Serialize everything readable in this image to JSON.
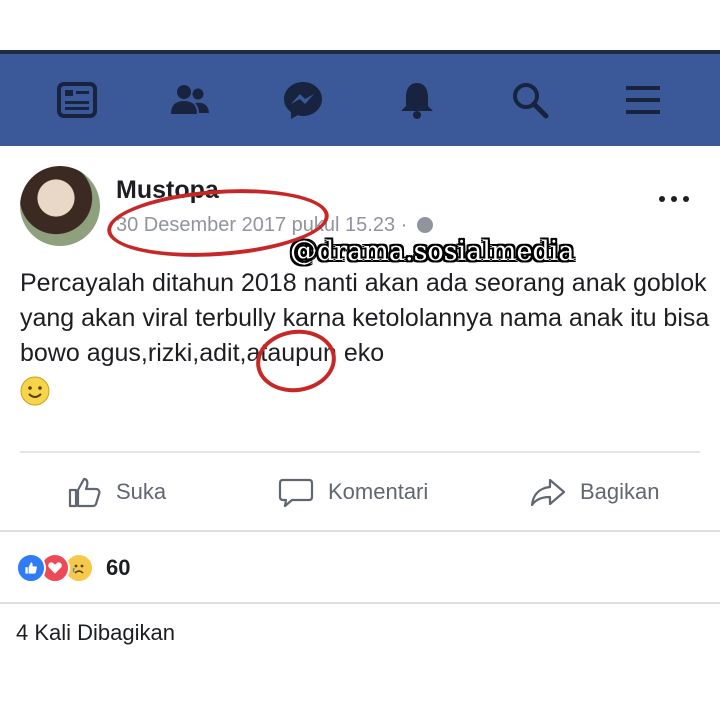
{
  "navbar": {
    "items": [
      {
        "name": "feed-icon"
      },
      {
        "name": "friends-icon"
      },
      {
        "name": "messenger-icon"
      },
      {
        "name": "notifications-icon"
      },
      {
        "name": "search-icon"
      },
      {
        "name": "menu-icon"
      }
    ],
    "color": "#3b5998"
  },
  "post": {
    "author": "Mustopa",
    "date": "30 Desember 2017",
    "time": "pukul 15.23 ·",
    "text": "Percayalah ditahun 2018 nanti akan ada seorang anak goblok yang akan viral terbully karna ketololannya nama anak itu bisa bowo agus,rizki,adit,ataupun eko",
    "emoji": "smiling-face-emoji"
  },
  "watermark": "@drama.sosialmedia",
  "actions": {
    "like": "Suka",
    "comment": "Komentari",
    "share": "Bagikan"
  },
  "reactions": {
    "count": "60",
    "types": [
      "like-reaction-icon",
      "love-reaction-icon",
      "sad-reaction-icon"
    ]
  },
  "shares": "4 Kali Dibagikan",
  "annotation_color": "#c62828"
}
